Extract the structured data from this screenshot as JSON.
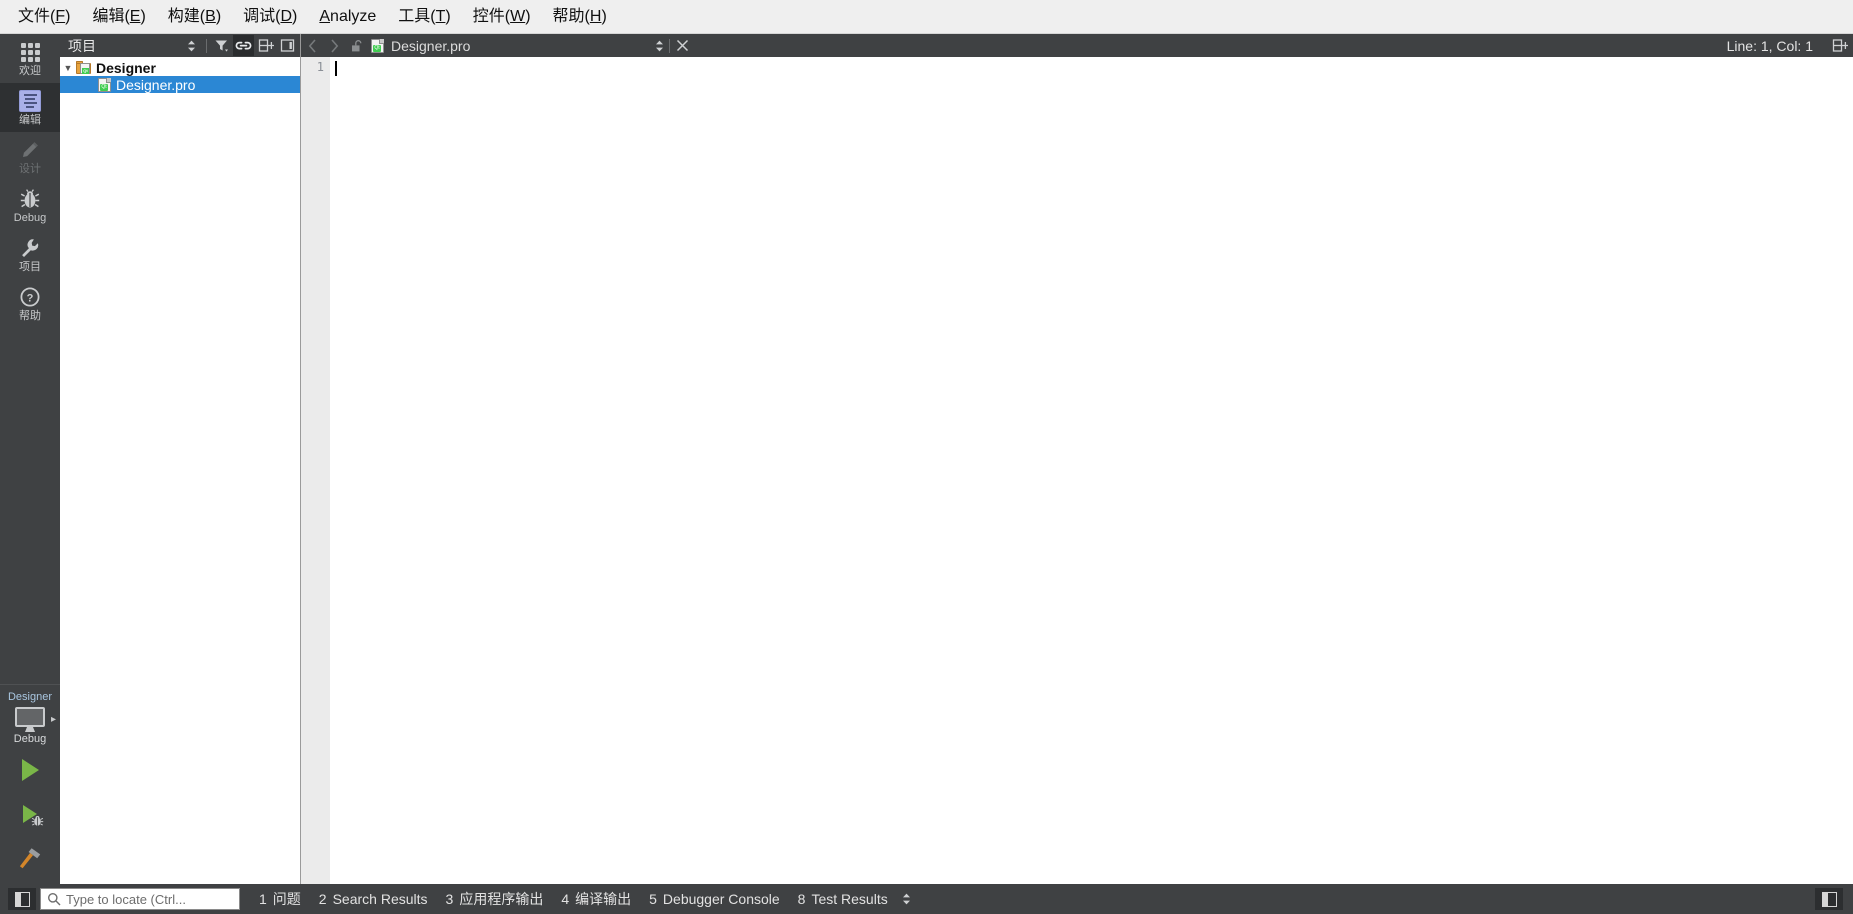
{
  "app": {
    "title": "Qt Creator",
    "accent_selection": "#2b87d4",
    "chrome_dark": "#3f4143",
    "chrome_dark_active": "#2e3032",
    "menu_bg": "#efefef",
    "qt_green": "#41cd52",
    "run_green": "#7ab648"
  },
  "menubar": {
    "items": [
      {
        "name": "file",
        "text": "文件(F)",
        "mnemonic": "F"
      },
      {
        "name": "edit",
        "text": "编辑(E)",
        "mnemonic": "E"
      },
      {
        "name": "build",
        "text": "构建(B)",
        "mnemonic": "B"
      },
      {
        "name": "debug",
        "text": "调试(D)",
        "mnemonic": "D"
      },
      {
        "name": "analyze",
        "text": "Analyze",
        "mnemonic": "A"
      },
      {
        "name": "tools",
        "text": "工具(T)",
        "mnemonic": "T"
      },
      {
        "name": "widgets",
        "text": "控件(W)",
        "mnemonic": "W"
      },
      {
        "name": "help",
        "text": "帮助(H)",
        "mnemonic": "H"
      }
    ]
  },
  "mode_rail": {
    "items": [
      {
        "name": "welcome",
        "label": "欢迎",
        "icon": "grid-icon",
        "state": "normal"
      },
      {
        "name": "edit",
        "label": "编辑",
        "icon": "editor-icon",
        "state": "active"
      },
      {
        "name": "design",
        "label": "设计",
        "icon": "pencil-icon",
        "state": "disabled"
      },
      {
        "name": "debug",
        "label": "Debug",
        "icon": "bug-icon",
        "state": "normal"
      },
      {
        "name": "projects",
        "label": "项目",
        "icon": "wrench-icon",
        "state": "normal"
      },
      {
        "name": "help",
        "label": "帮助",
        "icon": "question-icon",
        "state": "normal"
      }
    ],
    "kit_selector": {
      "project_name": "Designer",
      "build_config": "Debug",
      "icon": "monitor-icon",
      "arrow": "▸"
    },
    "actions": [
      {
        "name": "run",
        "icon": "play-icon",
        "tooltip": "Run"
      },
      {
        "name": "start-debugging",
        "icon": "play-bug-icon",
        "tooltip": "Start Debugging"
      },
      {
        "name": "build",
        "icon": "hammer-icon",
        "tooltip": "Build"
      }
    ]
  },
  "project_panel": {
    "title": "项目",
    "tools": [
      {
        "name": "view-selector",
        "icon": "updown-stepper-icon"
      },
      {
        "name": "filter-tree",
        "icon": "filter-icon"
      },
      {
        "name": "sync-selection",
        "icon": "link-icon",
        "active": true
      },
      {
        "name": "split-add",
        "icon": "split-add-icon"
      },
      {
        "name": "close-sidebar",
        "icon": "close-panel-icon"
      }
    ],
    "tree": [
      {
        "name": "project-root",
        "label": "Designer",
        "icon": "qt-project-folder-icon",
        "expanded": true,
        "selected": false,
        "depth": 0
      },
      {
        "name": "project-file",
        "label": "Designer.pro",
        "icon": "qt-pro-file-icon",
        "expanded": false,
        "selected": true,
        "depth": 1
      }
    ]
  },
  "editor": {
    "tabbar": {
      "back_icon": "chevron-left-icon",
      "forward_icon": "chevron-right-icon",
      "lock_icon": "unlocked-icon",
      "file_icon": "qt-pro-file-icon",
      "filename": "Designer.pro",
      "stepper_icon": "updown-stepper-icon",
      "close_icon": "close-icon",
      "position": "Line: 1, Col: 1",
      "split_icon": "split-add-icon"
    },
    "gutter": {
      "lines": [
        "1"
      ]
    },
    "content": {
      "lines": [
        ""
      ]
    },
    "caret": {
      "line": 1,
      "column": 1
    }
  },
  "statusbar": {
    "sidebar_toggle": {
      "name": "toggle-left-sidebar",
      "icon": "sidebar-icon"
    },
    "locator": {
      "icon": "search-icon",
      "placeholder": "Type to locate (Ctrl...",
      "value": ""
    },
    "output_tabs": [
      {
        "num": "1",
        "label": "问题"
      },
      {
        "num": "2",
        "label": "Search Results"
      },
      {
        "num": "3",
        "label": "应用程序输出"
      },
      {
        "num": "4",
        "label": "编译输出"
      },
      {
        "num": "5",
        "label": "Debugger Console"
      },
      {
        "num": "8",
        "label": "Test Results"
      }
    ],
    "stepper_icon": "updown-stepper-icon",
    "right_toggle": {
      "name": "toggle-right-sidebar",
      "icon": "sidebar-icon"
    }
  }
}
